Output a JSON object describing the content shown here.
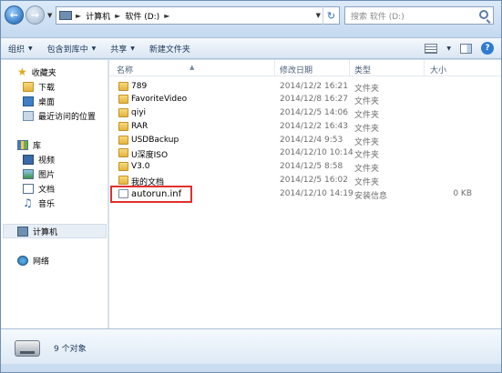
{
  "address": {
    "segments": [
      "计算机",
      "软件 (D:)"
    ]
  },
  "search": {
    "placeholder": "搜索 软件 (D:)"
  },
  "toolbar": {
    "organize": "组织",
    "include_library": "包含到库中",
    "share": "共享",
    "new_folder": "新建文件夹"
  },
  "nav": {
    "favorites": "收藏夹",
    "downloads": "下载",
    "desktop": "桌面",
    "recent": "最近访问的位置",
    "libraries": "库",
    "videos": "视频",
    "pictures": "图片",
    "documents": "文档",
    "music": "音乐",
    "computer": "计算机",
    "network": "网络"
  },
  "columns": {
    "name": "名称",
    "date": "修改日期",
    "type": "类型",
    "size": "大小"
  },
  "files": [
    {
      "name": "789",
      "date": "2014/12/2 16:21",
      "type": "文件夹",
      "size": "",
      "kind": "folder"
    },
    {
      "name": "FavoriteVideo",
      "date": "2014/12/8 16:27",
      "type": "文件夹",
      "size": "",
      "kind": "folder"
    },
    {
      "name": "qiyi",
      "date": "2014/12/5 14:06",
      "type": "文件夹",
      "size": "",
      "kind": "folder"
    },
    {
      "name": "RAR",
      "date": "2014/12/2 16:43",
      "type": "文件夹",
      "size": "",
      "kind": "folder"
    },
    {
      "name": "USDBackup",
      "date": "2014/12/4 9:53",
      "type": "文件夹",
      "size": "",
      "kind": "folder"
    },
    {
      "name": "U深度ISO",
      "date": "2014/12/10 10:14",
      "type": "文件夹",
      "size": "",
      "kind": "folder"
    },
    {
      "name": "V3.0",
      "date": "2014/12/5 8:58",
      "type": "文件夹",
      "size": "",
      "kind": "folder"
    },
    {
      "name": "我的文档",
      "date": "2014/12/5 16:02",
      "type": "文件夹",
      "size": "",
      "kind": "folder"
    },
    {
      "name": "autorun.inf",
      "date": "2014/12/10 14:19",
      "type": "安装信息",
      "size": "0 KB",
      "kind": "file"
    }
  ],
  "status": {
    "count": "9 个对象"
  },
  "colors": {
    "highlight": "#e0302e",
    "accent": "#3a7fc6"
  }
}
